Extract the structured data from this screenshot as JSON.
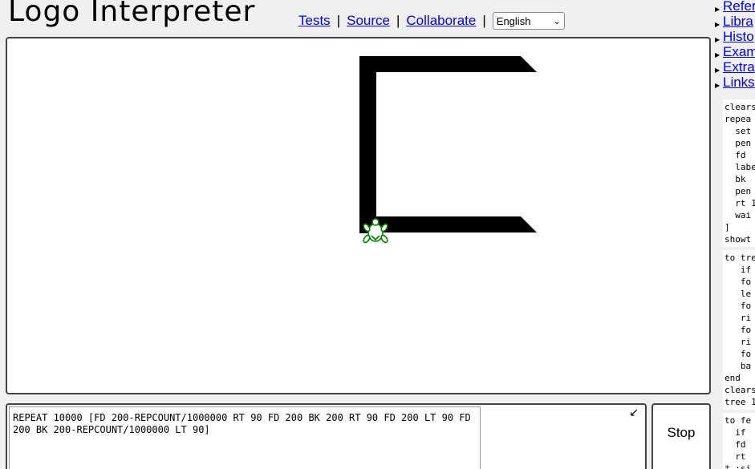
{
  "header": {
    "logo": "Logo Interpreter",
    "nav": {
      "tests": "Tests",
      "source": "Source",
      "collaborate": "Collaborate",
      "sep": "|"
    },
    "language": {
      "selected": "English"
    }
  },
  "sidebar": {
    "links": [
      "Refer",
      "Libra",
      "Histo",
      "Exam",
      "Extra",
      "Links"
    ]
  },
  "samples": [
    "clears\nrepea\n  set\n  pen\n  fd \n  labe\n  bk \n  pen\n  rt 1\n  wai\n]\nshowt",
    "to tre\n   if\n   fo\n   le\n   fo\n   ri\n   fo\n   ri\n   fo\n   ba\nend\nclears\ntree 1",
    "to fe\n  if \n  fd \n  rt \n* :si"
  ],
  "command": {
    "text": "REPEAT 10000 [FD 200-REPCOUNT/1000000 RT 90 FD 200 BK 200 RT 90 FD 200 LT 90 FD 200 BK 200-REPCOUNT/1000000 LT 90]",
    "expand_icon": "↙"
  },
  "stop_label": "Stop",
  "colors": {
    "link": "#0000ee",
    "turtle": "#008000",
    "ink": "#000000"
  }
}
